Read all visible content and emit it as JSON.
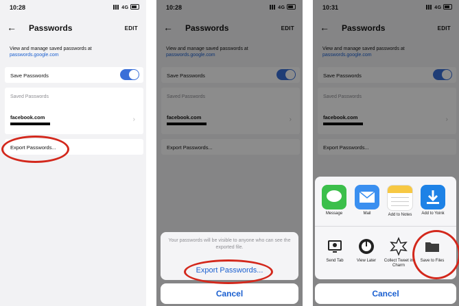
{
  "phones": [
    {
      "status": {
        "time": "10:28",
        "network": "4G"
      },
      "nav": {
        "title": "Passwords",
        "edit": "EDIT"
      },
      "description": "View and manage saved passwords at",
      "link": "passwords.google.com",
      "save_passwords": "Save Passwords",
      "saved_passwords": "Saved Passwords",
      "site": "facebook.com",
      "export": "Export Passwords..."
    },
    {
      "status": {
        "time": "10:28",
        "network": "4G"
      },
      "nav": {
        "title": "Passwords",
        "edit": "EDIT"
      },
      "description": "View and manage saved passwords at",
      "link": "passwords.google.com",
      "save_passwords": "Save Passwords",
      "saved_passwords": "Saved Passwords",
      "site": "facebook.com",
      "export": "Export Passwords...",
      "sheet": {
        "message": "Your passwords will be visible to anyone who can see the exported file.",
        "action": "Export Passwords...",
        "cancel": "Cancel"
      }
    },
    {
      "status": {
        "time": "10:31",
        "network": "4G"
      },
      "nav": {
        "title": "Passwords",
        "edit": "EDIT"
      },
      "description": "View and manage saved passwords at",
      "link": "passwords.google.com",
      "save_passwords": "Save Passwords",
      "saved_passwords": "Saved Passwords",
      "site": "facebook.com",
      "export": "Export Passwords...",
      "share": {
        "apps": [
          "Message",
          "Mail",
          "Add to Notes",
          "Add to Yoink"
        ],
        "actions": [
          "Send Tab",
          "View Later",
          "Collect Tweet in Charm",
          "Save to Files"
        ],
        "cancel": "Cancel"
      }
    }
  ],
  "colors": {
    "accent": "#1a5fd0",
    "toggle": "#3a6fd8",
    "highlight": "#d3281c"
  }
}
